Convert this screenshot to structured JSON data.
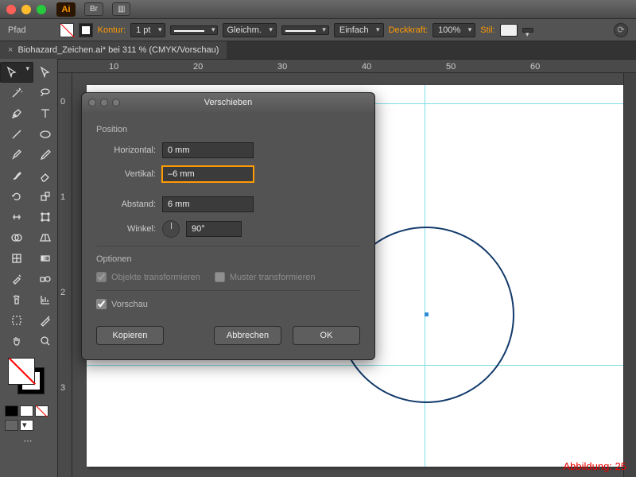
{
  "titlebar": {
    "br": "Br"
  },
  "ctrlbar": {
    "pfad": "Pfad",
    "kontur": "Kontur:",
    "pt": "1 pt",
    "gleich": "Gleichm.",
    "einfach": "Einfach",
    "deckkraft": "Deckkraft:",
    "deckVal": "100%",
    "stil": "Stil:"
  },
  "doc": {
    "title": "Biohazard_Zeichen.ai* bei 311 % (CMYK/Vorschau)"
  },
  "ruler": {
    "h": [
      "10",
      "20",
      "30",
      "40",
      "50",
      "60"
    ],
    "v": [
      "0",
      "1",
      "2",
      "3"
    ]
  },
  "dialog": {
    "title": "Verschieben",
    "pos": "Position",
    "horiz": "Horizontal:",
    "vert": "Vertikal:",
    "abst": "Abstand:",
    "winkel": "Winkel:",
    "hVal": "0 mm",
    "vVal": "–6 mm",
    "aVal": "6 mm",
    "wVal": "90°",
    "opts": "Optionen",
    "objTrans": "Objekte transformieren",
    "musterTrans": "Muster transformieren",
    "vorschau": "Vorschau",
    "kopieren": "Kopieren",
    "abbrechen": "Abbrechen",
    "ok": "OK"
  },
  "caption": "Abbildung: 25"
}
